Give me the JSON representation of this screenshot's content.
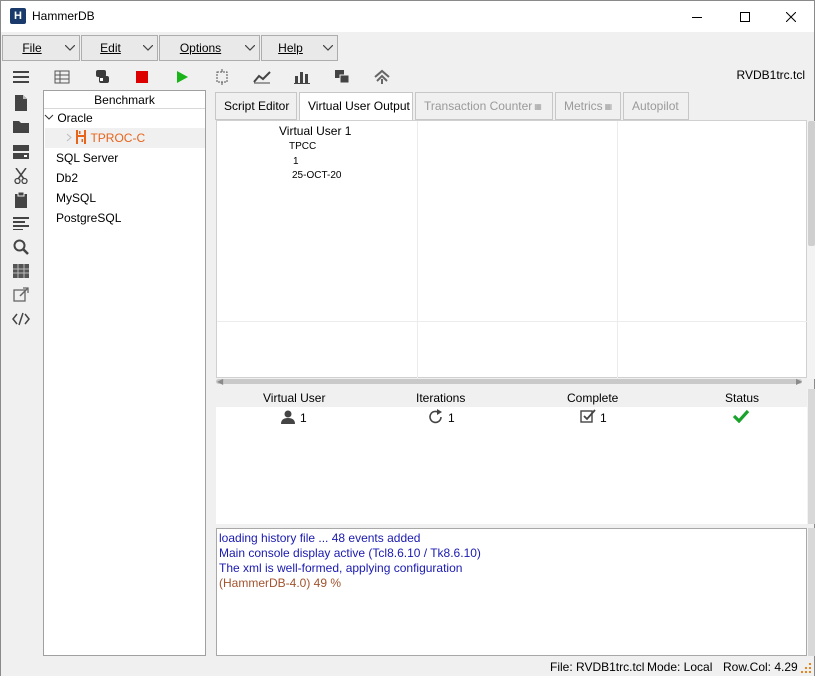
{
  "window": {
    "title": "HammerDB"
  },
  "menus": [
    {
      "label": "File"
    },
    {
      "label": "Edit"
    },
    {
      "label": "Options"
    },
    {
      "label": "Help"
    }
  ],
  "toolbar": {
    "script_file": "RVDB1trc.tcl",
    "icons": [
      "benchmark-grid-icon",
      "database-icon",
      "stop-icon",
      "run-icon",
      "transactions-icon",
      "metrics-line-icon",
      "bar-chart-icon",
      "stack-icon",
      "autopilot-icon"
    ],
    "colors": {
      "stop": "#dd0000",
      "run": "#18b418"
    }
  },
  "sidebar_icons": [
    "menu-icon",
    "document-icon",
    "folder-icon",
    "server-icon",
    "scissors-icon",
    "clipboard-icon",
    "list-icon",
    "search-icon",
    "grid-icon",
    "edit-external-icon",
    "code-icon"
  ],
  "tree": {
    "header": "Benchmark",
    "nodes": [
      "Oracle",
      "TPROC-C",
      "SQL Server",
      "Db2",
      "MySQL",
      "PostgreSQL"
    ],
    "selected_color": "#e8641b"
  },
  "tabs": [
    {
      "label": "Script Editor",
      "state": "normal"
    },
    {
      "label": "Virtual User Output",
      "state": "active"
    },
    {
      "label": "Transaction Counter",
      "state": "disabled"
    },
    {
      "label": "Metrics",
      "state": "disabled"
    },
    {
      "label": "Autopilot",
      "state": "disabled"
    }
  ],
  "vu_output": {
    "title": "Virtual User 1",
    "lines": [
      "TPCC",
      "1",
      "25-OCT-20"
    ]
  },
  "vu_table": {
    "headers": [
      "Virtual User",
      "Iterations",
      "Complete",
      "Status"
    ],
    "row": {
      "virtual_user": "1",
      "iterations": "1",
      "complete": "1",
      "status_color": "#1aa32a"
    }
  },
  "console": {
    "lines": [
      "loading history file ... 48 events added",
      "Main console display active (Tcl8.6.10 / Tk8.6.10)",
      "The xml is well-formed, applying configuration",
      "(HammerDB-4.0) 49 %"
    ]
  },
  "status": {
    "file": "File: RVDB1trc.tcl",
    "mode": "Mode: Local",
    "rowcol": "Row.Col:  4.29"
  }
}
